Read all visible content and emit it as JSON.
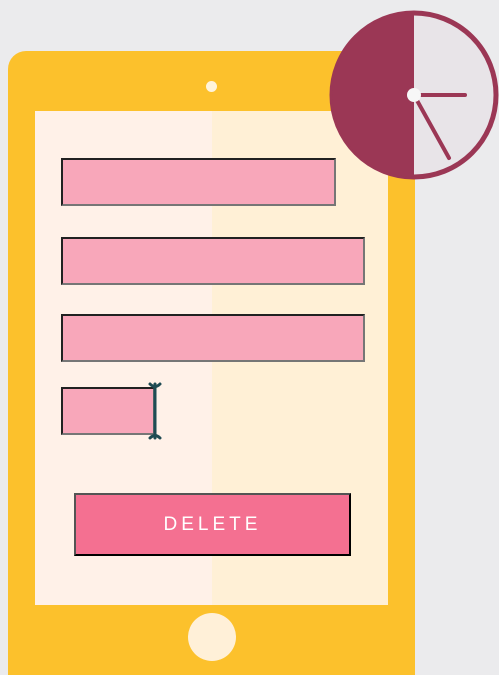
{
  "form": {
    "fields": [
      {
        "value": "",
        "placeholder": ""
      },
      {
        "value": "",
        "placeholder": ""
      },
      {
        "value": "",
        "placeholder": ""
      },
      {
        "value": "",
        "placeholder": ""
      }
    ]
  },
  "actions": {
    "delete_label": "DELETE"
  },
  "icons": {
    "camera": "camera-dot",
    "home": "home-button",
    "cursor": "text-cursor-icon",
    "clock": "clock-icon"
  },
  "colors": {
    "background": "#ebebed",
    "tablet": "#fcc12c",
    "screen_left": "#fff1e8",
    "screen_right": "#fff0d6",
    "field": "#f8a7ba",
    "button": "#f47091",
    "cursor": "#1f4b53",
    "clock": "#9b3755"
  }
}
